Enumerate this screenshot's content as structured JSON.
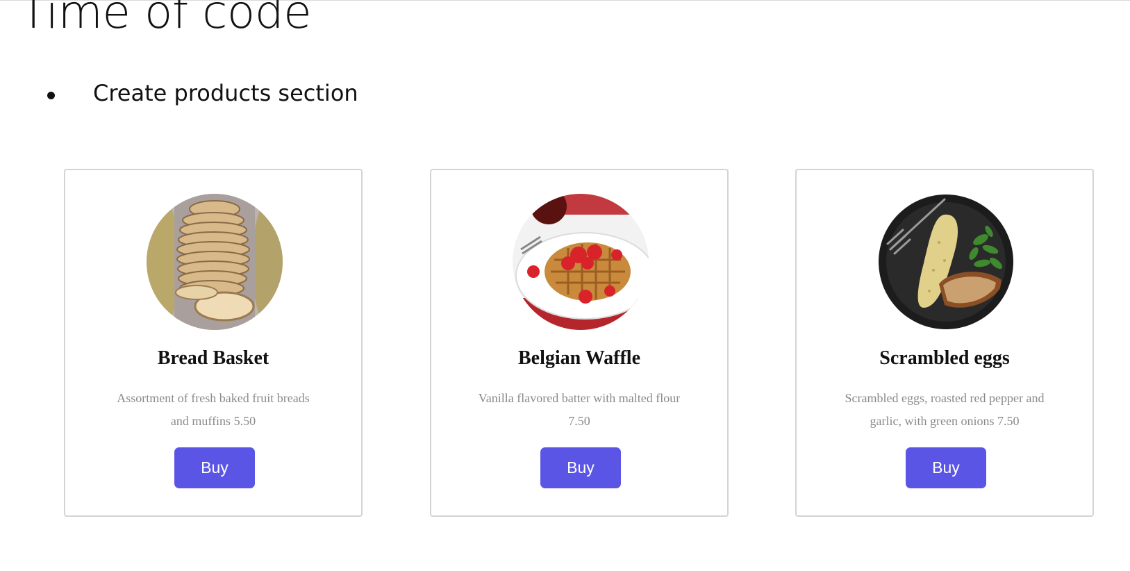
{
  "slide": {
    "title": "Time of code",
    "bullet": "Create products section"
  },
  "products": [
    {
      "name": "Bread Basket",
      "description": "Assortment of fresh baked fruit breads and muffins 5.50",
      "button_label": "Buy",
      "image_icon": "bread-photo"
    },
    {
      "name": "Belgian Waffle",
      "description": "Vanilla flavored batter with malted flour 7.50",
      "button_label": "Buy",
      "image_icon": "waffle-photo"
    },
    {
      "name": "Scrambled eggs",
      "description": "Scrambled eggs, roasted red pepper and garlic, with green onions 7.50",
      "button_label": "Buy",
      "image_icon": "eggs-photo"
    }
  ],
  "colors": {
    "button": "#5b55e6",
    "description_text": "#8a8a8a",
    "card_border": "#d4d4d4"
  }
}
